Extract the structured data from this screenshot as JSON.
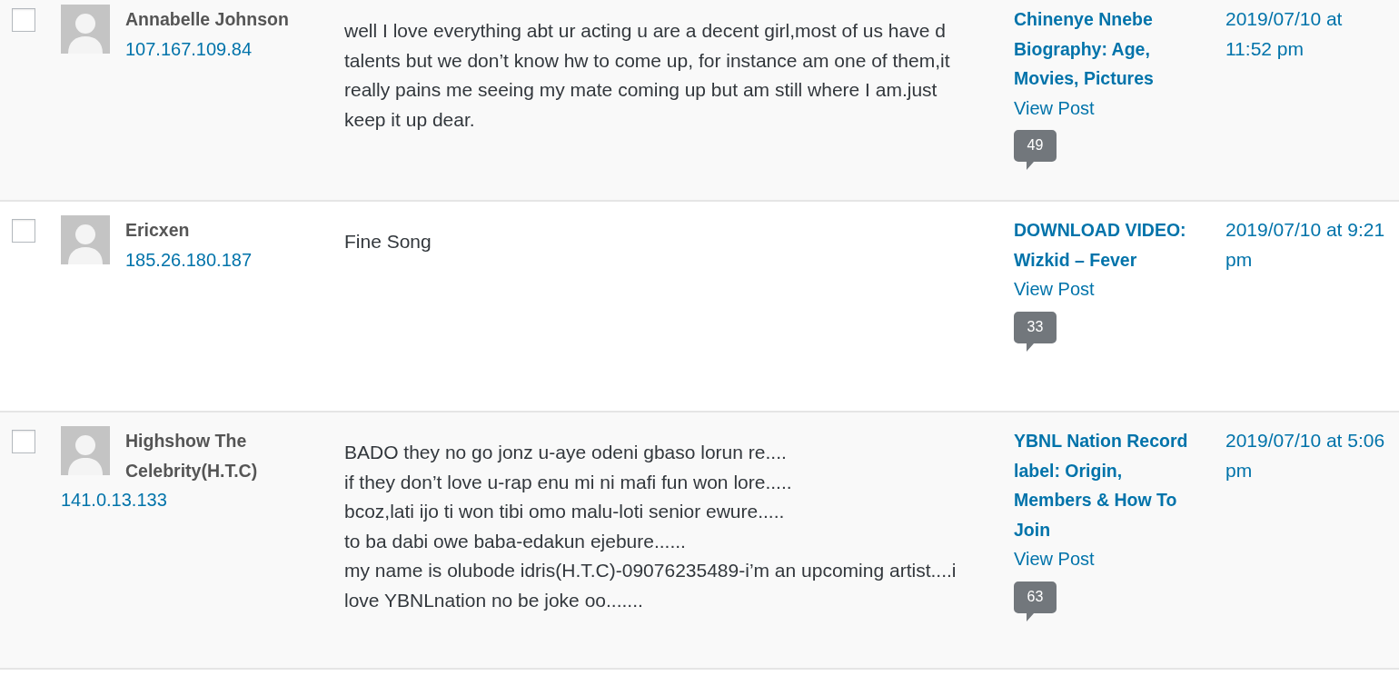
{
  "comments": [
    {
      "checked": false,
      "author_name": "Annabelle Johnson",
      "author_ip": "107.167.109.84",
      "comment": "well I love everything abt ur acting u are a decent girl,most of us have d talents but we don’t know hw to come up, for instance am one of them,it really pains me seeing my mate coming up but am still where I am.just keep it up dear.",
      "post_title": "Chinenye Nnebe Biography: Age, Movies, Pictures",
      "view_post": "View Post",
      "count": "49",
      "submitted_on": "2019/07/10 at 11:52 pm"
    },
    {
      "checked": false,
      "author_name": "Ericxen",
      "author_ip": "185.26.180.187",
      "comment": "Fine Song",
      "post_title": "DOWNLOAD VIDEO: Wizkid – Fever",
      "view_post": "View Post",
      "count": "33",
      "submitted_on": "2019/07/10 at 9:21 pm"
    },
    {
      "checked": false,
      "author_name": "Highshow The Celebrity(H.T.C)",
      "author_ip": "141.0.13.133",
      "comment": "BADO they no go jonz u-aye odeni gbaso lorun re....\nif they don’t love u-rap enu mi ni mafi fun won lore.....\nbcoz,lati ijo ti won tibi omo malu-loti senior ewure.....\nto ba dabi owe baba-edakun ejebure......\nmy name is olubode idris(H.T.C)-09076235489-i’m an upcoming artist....i love YBNLnation no be joke oo.......",
      "post_title": "YBNL Nation Record label: Origin, Members & How To Join",
      "view_post": "View Post",
      "count": "63",
      "submitted_on": "2019/07/10 at 5:06 pm"
    }
  ]
}
